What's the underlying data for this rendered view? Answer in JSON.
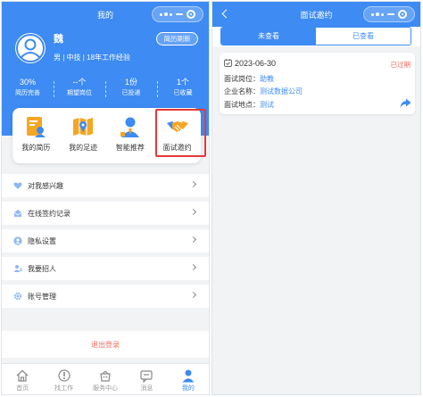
{
  "left": {
    "title": "我的",
    "user": {
      "name": "魏",
      "meta": "男 | 中技 | 18年工作经验"
    },
    "refresh_button": "简历刷新",
    "stats": [
      {
        "value": "30%",
        "label": "简历完善"
      },
      {
        "value": "--个",
        "label": "期望岗位"
      },
      {
        "value": "1份",
        "label": "已投递"
      },
      {
        "value": "1个",
        "label": "已收藏"
      }
    ],
    "quick_actions": [
      {
        "label": "我的简历",
        "icon": "resume-icon"
      },
      {
        "label": "我的足迹",
        "icon": "map-icon"
      },
      {
        "label": "智能推荐",
        "icon": "recommend-person-icon"
      },
      {
        "label": "面试邀约",
        "icon": "handshake-icon",
        "highlighted": true
      }
    ],
    "menu": [
      {
        "label": "对我感兴趣",
        "icon": "heart-icon"
      },
      {
        "label": "在线签约记录",
        "icon": "envelope-icon"
      },
      {
        "label": "隐私设置",
        "icon": "privacy-user-icon"
      },
      {
        "label": "我要招人",
        "icon": "recruit-icon"
      },
      {
        "label": "账号管理",
        "icon": "settings-gear-icon"
      }
    ],
    "logout": "退出登录",
    "tabs": [
      {
        "label": "首页",
        "icon": "home-icon"
      },
      {
        "label": "找工作",
        "icon": "find-job-icon"
      },
      {
        "label": "服务中心",
        "icon": "service-center-icon"
      },
      {
        "label": "消息",
        "icon": "message-icon"
      },
      {
        "label": "我的",
        "icon": "profile-icon",
        "active": true
      }
    ]
  },
  "right": {
    "title": "面试邀约",
    "segments": [
      {
        "label": "未查看",
        "active": true
      },
      {
        "label": "已查看",
        "active": false
      }
    ],
    "card": {
      "date": "2023-06-30",
      "status": "已过期",
      "rows": [
        {
          "key": "面试岗位：",
          "value": "助教"
        },
        {
          "key": "企业名称：",
          "value": "测试数据公司"
        },
        {
          "key": "面试地点：",
          "value": "测试"
        }
      ]
    }
  },
  "colors": {
    "primary": "#3d8bf3",
    "expired": "#f26b5c",
    "highlight_frame": "#e53935",
    "background": "#f2f3f5"
  }
}
